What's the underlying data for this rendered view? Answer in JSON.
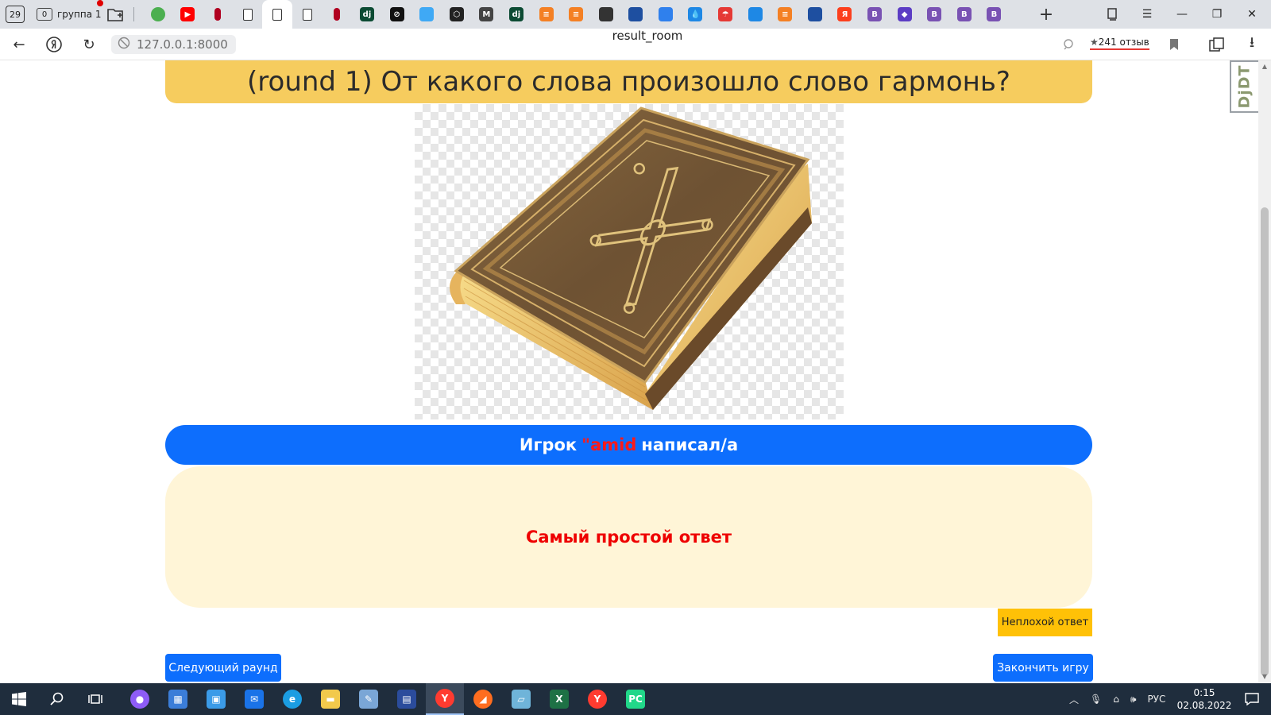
{
  "browser": {
    "tab_count": "29",
    "group_count": "0",
    "group_label": "группа 1",
    "url": "127.0.0.1:8000",
    "page_title": "result_room",
    "reviews": "241 отзыв",
    "pinned_tabs": [
      {
        "icon": "chrome-like-icon",
        "color": "#4caf50",
        "text": ""
      },
      {
        "icon": "youtube-icon",
        "color": "#ff0000",
        "text": "▶"
      },
      {
        "icon": "red-dots-icon",
        "color": "#b00020",
        "text": ""
      },
      {
        "icon": "document-icon",
        "color": "",
        "text": ""
      },
      {
        "icon": "document-icon",
        "color": "",
        "text": ""
      },
      {
        "icon": "document-icon",
        "color": "",
        "text": ""
      },
      {
        "icon": "red-dots-icon",
        "color": "#b00020",
        "text": ""
      },
      {
        "icon": "django-icon",
        "color": "#0c4b33",
        "text": "dj"
      },
      {
        "icon": "circle-slash-icon",
        "color": "#111111",
        "text": "⊘"
      },
      {
        "icon": "cube-icon",
        "color": "#3fa9f5",
        "text": ""
      },
      {
        "icon": "hex-icon",
        "color": "#222222",
        "text": "⬡"
      },
      {
        "icon": "gmail-icon",
        "color": "#444444",
        "text": "M"
      },
      {
        "icon": "django-icon",
        "color": "#0c4b33",
        "text": "dj"
      },
      {
        "icon": "stackoverflow-icon",
        "color": "#f48024",
        "text": "≡"
      },
      {
        "icon": "stackoverflow-icon",
        "color": "#f48024",
        "text": "≡"
      },
      {
        "icon": "dark-square-icon",
        "color": "#333333",
        "text": ""
      },
      {
        "icon": "blue-square-icon",
        "color": "#1e4fa0",
        "text": ""
      },
      {
        "icon": "camera-icon",
        "color": "#2f80ed",
        "text": ""
      },
      {
        "icon": "drop-icon",
        "color": "#1e88e5",
        "text": "💧"
      },
      {
        "icon": "umbrella-icon",
        "color": "#e53935",
        "text": "☂"
      },
      {
        "icon": "drop-icon",
        "color": "#1e88e5",
        "text": ""
      },
      {
        "icon": "stackoverflow-icon",
        "color": "#f48024",
        "text": "≡"
      },
      {
        "icon": "blue-square-icon",
        "color": "#1e4fa0",
        "text": ""
      },
      {
        "icon": "yandex-icon",
        "color": "#fc3f1d",
        "text": "Я"
      },
      {
        "icon": "bootstrap-icon",
        "color": "#7952b3",
        "text": "B"
      },
      {
        "icon": "layers-icon",
        "color": "#5b3cc4",
        "text": "◆"
      },
      {
        "icon": "bootstrap-icon",
        "color": "#7952b3",
        "text": "B"
      },
      {
        "icon": "bootstrap-icon",
        "color": "#7952b3",
        "text": "B"
      },
      {
        "icon": "bootstrap-icon",
        "color": "#7952b3",
        "text": "B"
      }
    ]
  },
  "page": {
    "question": "(round 1) От какого слова произошло слово гармонь?",
    "player_prefix": "Игрок",
    "player_name": "\"amid",
    "player_suffix": "написал/а",
    "answer": "Самый простой ответ",
    "good_answer_button": "Неплохой ответ",
    "next_round_button": "Следующий раунд",
    "end_game_button": "Закончить игру",
    "debug_toolbar_label": "DjDT"
  },
  "colors": {
    "banner_yellow": "#f6cc5e",
    "primary_blue": "#0d6efd",
    "answer_bg": "#fff5d7",
    "answer_red": "#ee0000",
    "warning_yellow": "#ffc107"
  },
  "taskbar": {
    "apps": [
      {
        "icon": "alice-icon",
        "color": "#8e5cf7",
        "text": "●"
      },
      {
        "icon": "store-icon",
        "color": "#3b7dd8",
        "text": "▦"
      },
      {
        "icon": "monitor-icon",
        "color": "#3b9be8",
        "text": "▣"
      },
      {
        "icon": "mail-icon",
        "color": "#1a73e8",
        "text": "✉"
      },
      {
        "icon": "edge-icon",
        "color": "#1b9de2",
        "text": "e"
      },
      {
        "icon": "explorer-icon",
        "color": "#f2c94c",
        "text": "▬"
      },
      {
        "icon": "paint-icon",
        "color": "#7aa6d6",
        "text": "✎"
      },
      {
        "icon": "save-icon",
        "color": "#2b4c9c",
        "text": "▤"
      },
      {
        "icon": "yandex-browser-icon",
        "color": "#ff3b30",
        "text": "Y"
      },
      {
        "icon": "compass-icon",
        "color": "#ff6d1f",
        "text": "◢"
      },
      {
        "icon": "notepad-icon",
        "color": "#6fb4d9",
        "text": "▱"
      },
      {
        "icon": "excel-icon",
        "color": "#1e7145",
        "text": "X"
      },
      {
        "icon": "yandex-browser-icon",
        "color": "#ff3b30",
        "text": "Y"
      },
      {
        "icon": "pycharm-icon",
        "color": "#21d789",
        "text": "PC"
      }
    ],
    "language": "РУС",
    "time": "0:15",
    "date": "02.08.2022"
  }
}
